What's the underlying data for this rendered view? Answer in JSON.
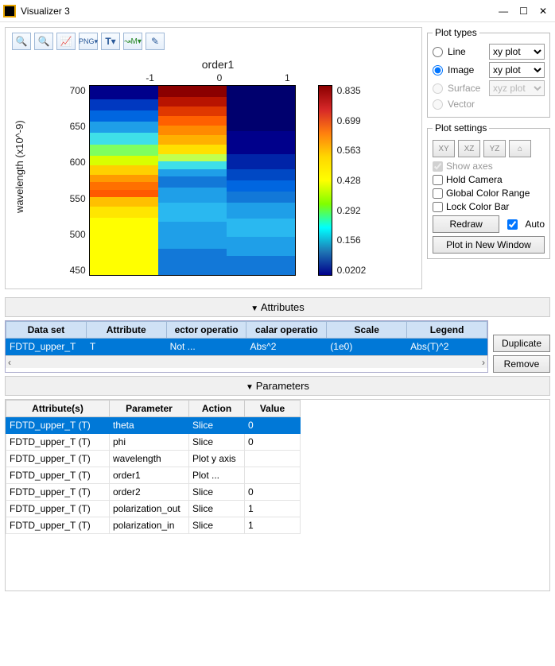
{
  "window": {
    "title": "Visualizer 3"
  },
  "toolbar_icons": [
    "magnify",
    "magnify-minus",
    "chart-area",
    "png",
    "text",
    "ruler-m",
    "pencil"
  ],
  "plot_types": {
    "legend": "Plot types",
    "options": [
      {
        "label": "Line",
        "select": "xy plot",
        "checked": false,
        "disabled": false
      },
      {
        "label": "Image",
        "select": "xy plot",
        "checked": true,
        "disabled": false
      },
      {
        "label": "Surface",
        "select": "xyz plot",
        "checked": false,
        "disabled": true
      },
      {
        "label": "Vector",
        "select": "",
        "checked": false,
        "disabled": true
      }
    ]
  },
  "plot_settings": {
    "legend": "Plot settings",
    "view_buttons": [
      "XY",
      "XZ",
      "YZ",
      "⌂"
    ],
    "show_axes": {
      "label": "Show axes",
      "checked": true,
      "disabled": true
    },
    "hold_camera": {
      "label": "Hold Camera",
      "checked": false
    },
    "global_color": {
      "label": "Global Color Range",
      "checked": false
    },
    "lock_color": {
      "label": "Lock Color Bar",
      "checked": false
    },
    "redraw": "Redraw",
    "auto": {
      "label": "Auto",
      "checked": true
    },
    "new_window": "Plot in New Window"
  },
  "attributes": {
    "header": "Attributes",
    "columns": [
      "Data set",
      "Attribute",
      "ector operatio",
      "calar operatio",
      "Scale",
      "Legend"
    ],
    "rows": [
      {
        "dataset": "FDTD_upper_T",
        "attribute": "T",
        "vec": "Not ...",
        "scalar": "Abs^2",
        "scale": "(1e0)",
        "legend": "Abs(T)^2",
        "selected": true
      }
    ],
    "side_buttons": [
      "Duplicate",
      "Remove"
    ]
  },
  "parameters": {
    "header": "Parameters",
    "columns": [
      "Attribute(s)",
      "Parameter",
      "Action",
      "Value"
    ],
    "rows": [
      {
        "attr": "FDTD_upper_T (T)",
        "param": "theta",
        "action": "Slice",
        "value": "0",
        "selected": true
      },
      {
        "attr": "FDTD_upper_T (T)",
        "param": "phi",
        "action": "Slice",
        "value": "0"
      },
      {
        "attr": "FDTD_upper_T (T)",
        "param": "wavelength",
        "action": "Plot y axis",
        "value": ""
      },
      {
        "attr": "FDTD_upper_T (T)",
        "param": "order1",
        "action": "Plot ...",
        "value": ""
      },
      {
        "attr": "FDTD_upper_T (T)",
        "param": "order2",
        "action": "Slice",
        "value": "0"
      },
      {
        "attr": "FDTD_upper_T (T)",
        "param": "polarization_out",
        "action": "Slice",
        "value": "1"
      },
      {
        "attr": "FDTD_upper_T (T)",
        "param": "polarization_in",
        "action": "Slice",
        "value": "1"
      }
    ]
  },
  "chart_data": {
    "type": "heatmap",
    "title": "order1",
    "xlabel": "order1",
    "ylabel": "wavelength (x10^-9)",
    "x_categories": [
      "-1",
      "0",
      "1"
    ],
    "y_ticks": [
      700,
      650,
      600,
      550,
      500,
      450
    ],
    "ylim": [
      420,
      710
    ],
    "colorbar": {
      "ticks": [
        0.835,
        0.699,
        0.563,
        0.428,
        0.292,
        0.156,
        0.0202
      ],
      "range": [
        0.0202,
        0.835
      ]
    },
    "columns": [
      {
        "x": "-1",
        "segments": [
          {
            "color": "#00008b",
            "height_pct": 7
          },
          {
            "color": "#0038c0",
            "height_pct": 6
          },
          {
            "color": "#0066e0",
            "height_pct": 6
          },
          {
            "color": "#1f9fe8",
            "height_pct": 6
          },
          {
            "color": "#3fdfe8",
            "height_pct": 6
          },
          {
            "color": "#7fff5f",
            "height_pct": 6
          },
          {
            "color": "#d9ff00",
            "height_pct": 5
          },
          {
            "color": "#ffd000",
            "height_pct": 5
          },
          {
            "color": "#ff9a00",
            "height_pct": 4
          },
          {
            "color": "#ff7000",
            "height_pct": 4
          },
          {
            "color": "#ff5a00",
            "height_pct": 4
          },
          {
            "color": "#ffc000",
            "height_pct": 5
          },
          {
            "color": "#ffe600",
            "height_pct": 6
          },
          {
            "color": "#ffff00",
            "height_pct": 30
          }
        ]
      },
      {
        "x": "0",
        "segments": [
          {
            "color": "#8b0000",
            "height_pct": 6
          },
          {
            "color": "#b81400",
            "height_pct": 5
          },
          {
            "color": "#e03800",
            "height_pct": 5
          },
          {
            "color": "#ff6000",
            "height_pct": 5
          },
          {
            "color": "#ff8a00",
            "height_pct": 5
          },
          {
            "color": "#ffb000",
            "height_pct": 5
          },
          {
            "color": "#ffe000",
            "height_pct": 5
          },
          {
            "color": "#c0ff4f",
            "height_pct": 4
          },
          {
            "color": "#3fdfe8",
            "height_pct": 4
          },
          {
            "color": "#1f9fe8",
            "height_pct": 4
          },
          {
            "color": "#1278d8",
            "height_pct": 6
          },
          {
            "color": "#1f9fe8",
            "height_pct": 8
          },
          {
            "color": "#2ab8f0",
            "height_pct": 10
          },
          {
            "color": "#1f9fe8",
            "height_pct": 14
          },
          {
            "color": "#1278d8",
            "height_pct": 14
          }
        ]
      },
      {
        "x": "1",
        "segments": [
          {
            "color": "#00006e",
            "height_pct": 24
          },
          {
            "color": "#00008b",
            "height_pct": 12
          },
          {
            "color": "#0024a8",
            "height_pct": 8
          },
          {
            "color": "#0048c4",
            "height_pct": 6
          },
          {
            "color": "#0066e0",
            "height_pct": 6
          },
          {
            "color": "#1278d8",
            "height_pct": 6
          },
          {
            "color": "#1f9fe8",
            "height_pct": 8
          },
          {
            "color": "#2ab8f0",
            "height_pct": 10
          },
          {
            "color": "#1f9fe8",
            "height_pct": 10
          },
          {
            "color": "#1278d8",
            "height_pct": 10
          }
        ]
      }
    ]
  }
}
